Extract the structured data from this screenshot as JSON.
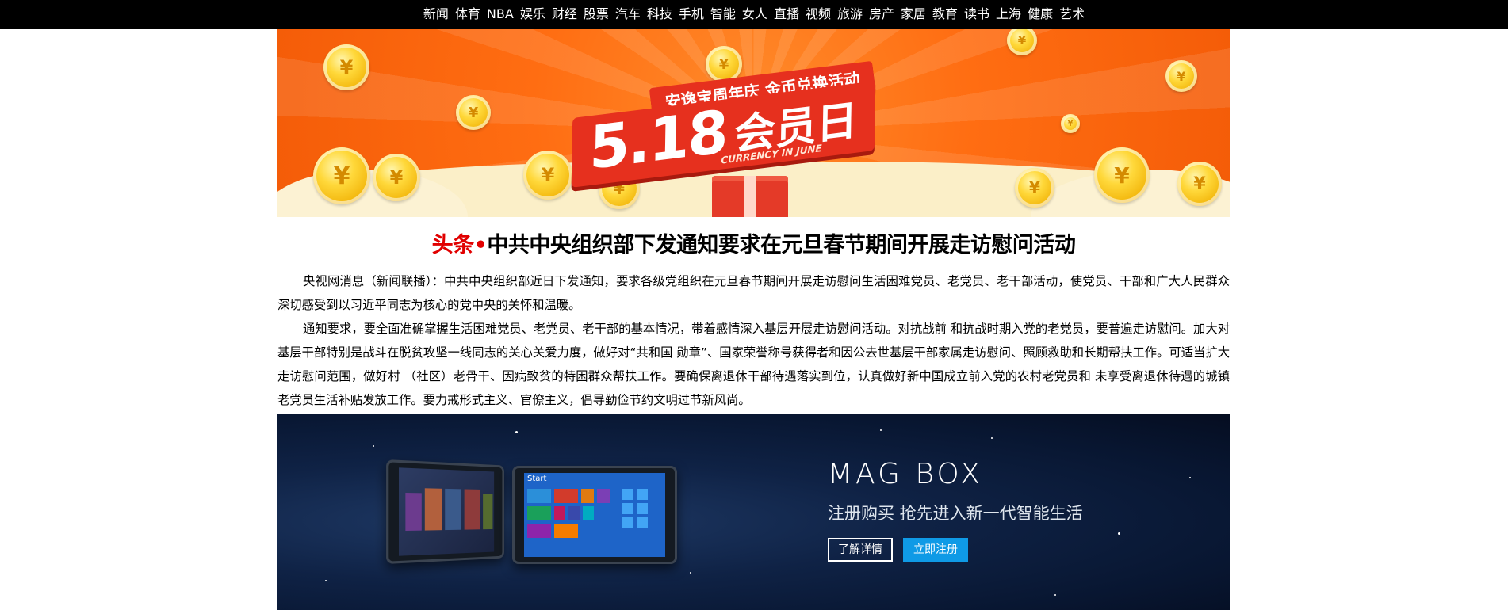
{
  "nav": {
    "items": [
      "新闻",
      "体育",
      "NBA",
      "娱乐",
      "财经",
      "股票",
      "汽车",
      "科技",
      "手机",
      "智能",
      "女人",
      "直播",
      "视频",
      "旅游",
      "房产",
      "家居",
      "教育",
      "读书",
      "上海",
      "健康",
      "艺术"
    ]
  },
  "banner_top": {
    "tagline": "安逸宝周年庆 金币兑换活动",
    "big_number": "5.18",
    "big_text": "会员日",
    "english": "CURRENCY IN JUNE",
    "colors": {
      "background": "#ff6d12",
      "accent": "#e6301e",
      "coin": "#ffd83a"
    }
  },
  "headline": {
    "prefix": "头条•",
    "title": "中共中央组织部下发通知要求在元旦春节期间开展走访慰问活动"
  },
  "article": {
    "paragraphs": [
      "央视网消息（新闻联播）：中共中央组织部近日下发通知，要求各级党组织在元旦春节期间开展走访慰问生活困难党员、老党员、老干部活动，使党员、干部和广大人民群众深切感受到以习近平同志为核心的党中央的关怀和温暖。",
      "通知要求，要全面准确掌握生活困难党员、老党员、老干部的基本情况，带着感情深入基层开展走访慰问活动。对抗战前 和抗战时期入党的老党员，要普遍走访慰问。加大对基层干部特别是战斗在脱贫攻坚一线同志的关心关爱力度，做好对“共和国 勋章”、国家荣誉称号获得者和因公去世基层干部家属走访慰问、照顾救助和长期帮扶工作。可适当扩大走访慰问范围，做好村 （社区）老骨干、因病致贫的特困群众帮扶工作。要确保离退休干部待遇落实到位，认真做好新中国成立前入党的农村老党员和 未享受离退休待遇的城镇老党员生活补贴发放工作。要力戒形式主义、官僚主义，倡导勤俭节约文明过节新风尚。"
    ]
  },
  "banner_bottom": {
    "brand": "MAG BOX",
    "subtitle": "注册购买  抢先进入新一代智能生活",
    "learn_more": "了解详情",
    "register": "立即注册",
    "tablet_label": "Start",
    "colors": {
      "background": "#0f2245",
      "button": "#0f9ae6"
    }
  }
}
